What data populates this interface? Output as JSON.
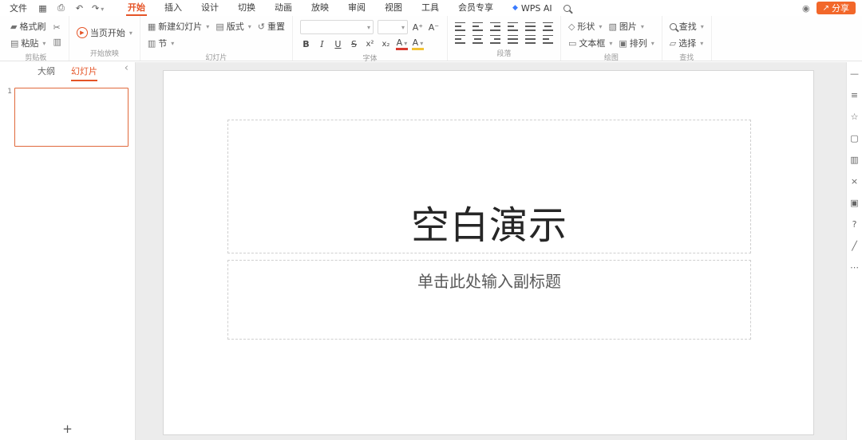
{
  "colors": {
    "accent": "#e55427",
    "share_button": "#f2672a",
    "canvas_bg": "#ececec"
  },
  "menubar": {
    "file": "文件",
    "tabs": [
      {
        "label": "开始",
        "active": true
      },
      {
        "label": "插入"
      },
      {
        "label": "设计"
      },
      {
        "label": "切换"
      },
      {
        "label": "动画"
      },
      {
        "label": "放映"
      },
      {
        "label": "审阅"
      },
      {
        "label": "视图"
      },
      {
        "label": "工具"
      },
      {
        "label": "会员专享"
      }
    ],
    "wps_ai": "WPS AI",
    "share": "分享"
  },
  "ribbon": {
    "clipboard": {
      "format_painter": "格式刷",
      "paste": "粘贴",
      "label": "剪贴板"
    },
    "slideshow": {
      "from_current": "当页开始",
      "label": "开始放映"
    },
    "slides": {
      "new_slide": "新建幻灯片",
      "layout": "版式",
      "section": "节",
      "reset": "重置",
      "label": "幻灯片"
    },
    "font": {
      "bold": "B",
      "italic": "I",
      "underline": "U",
      "strike": "S",
      "superscript": "x²",
      "subscript": "x₂",
      "increase": "A⁺",
      "decrease": "A⁻",
      "color": "A",
      "highlight": "A",
      "label": "字体"
    },
    "paragraph": {
      "label": "段落"
    },
    "drawing": {
      "shapes": "形状",
      "picture": "图片",
      "textbox": "文本框",
      "arrange": "排列",
      "label": "绘图"
    },
    "editing": {
      "find": "查找",
      "select": "选择",
      "label": "查找"
    }
  },
  "sidebar": {
    "outline_tab": "大纲",
    "slides_tab": "幻灯片",
    "slide_number": "1",
    "add": "+"
  },
  "slide": {
    "title": "空白演示",
    "subtitle": "单击此处输入副标题"
  },
  "icons": {
    "save": "▦",
    "print": "⎙",
    "undo": "↶",
    "redo": "↷",
    "wps_ai": "◆",
    "eye": "◉",
    "share": "↗",
    "brush": "▰",
    "paste": "▤",
    "cut": "✂",
    "copy": "▥",
    "play": "▶",
    "new_slide": "▦",
    "layout": "▤",
    "section": "▥",
    "reset": "↺",
    "shapes": "◇",
    "picture": "▧",
    "textbox": "▭",
    "arrange": "▣",
    "select": "▱",
    "collapse": "‹"
  },
  "rightbar": [
    "—",
    "≡",
    "☆",
    "▢",
    "▥",
    "×",
    "▣",
    "?",
    "╱",
    "⋯"
  ]
}
